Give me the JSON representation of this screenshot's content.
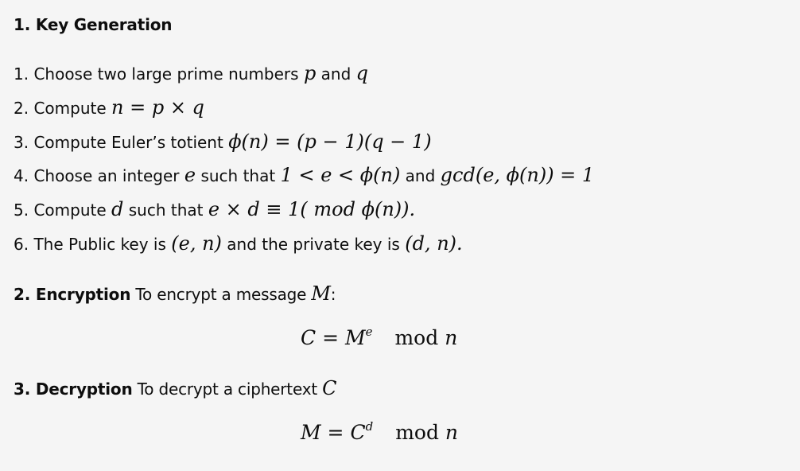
{
  "sections": {
    "key_gen": {
      "title": "1. Key Generation",
      "steps": [
        {
          "text": "1. Choose two large prime numbers",
          "math1": "p",
          "mid": " and ",
          "math2": "q"
        },
        {
          "text": "2. Compute",
          "math1": "n = p × q"
        },
        {
          "text": "3. Compute Euler’s totient",
          "math1": "ϕ(n) = (p − 1)(q − 1)"
        },
        {
          "text": "4. Choose an integer",
          "math1": "e",
          "mid": " such that ",
          "math2": "1 < e < ϕ(n)",
          "mid2": " and ",
          "math3": "gcd(e, ϕ(n)) = 1"
        },
        {
          "text": "5. Compute",
          "math1": "d",
          "mid": " such that ",
          "math2": "e × d ≡ 1(  mod ϕ(n))."
        },
        {
          "text": "6. The Public key is",
          "math1": "(e, n)",
          "mid": " and the private key is ",
          "math2": "(d, n)."
        }
      ]
    },
    "encryption": {
      "title_bold": "2. Encryption",
      "title_rest": " To encrypt a message ",
      "title_math": "M",
      "title_tail": ":",
      "formula_lhs": "C = M",
      "formula_exp": "e",
      "formula_mod": "mod",
      "formula_var": "n"
    },
    "decryption": {
      "title_bold": "3. Decryption",
      "title_rest": " To decrypt a ciphertext ",
      "title_math": "C",
      "formula_lhs": "M = C",
      "formula_exp": "d",
      "formula_mod": "mod",
      "formula_var": "n"
    }
  }
}
